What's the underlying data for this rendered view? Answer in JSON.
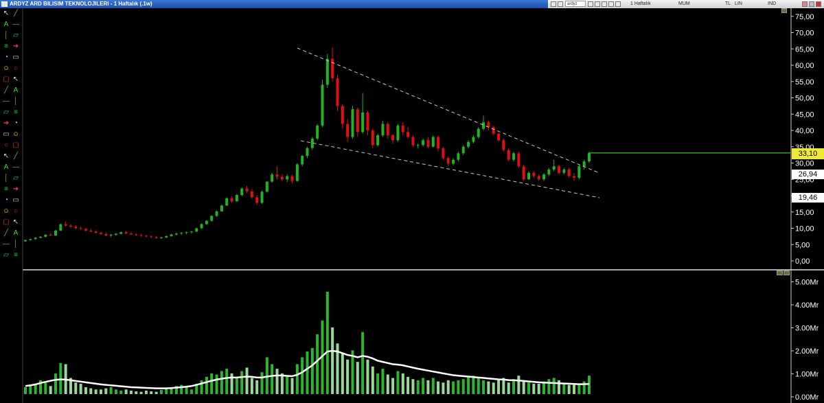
{
  "window": {
    "title": "ARDYZ ARD BILISIM TEKNOLOJILERI - 1 Haftalık (.1w)"
  },
  "toolbar_top": {
    "symbol_value": "ardyz",
    "period_label": "1 Haftalık",
    "mode_labels": [
      "MUM",
      "TL",
      "LIN",
      "IND"
    ]
  },
  "price_axis": {
    "ticks": [
      "75,00",
      "70,00",
      "65,00",
      "60,00",
      "55,00",
      "50,00",
      "45,00",
      "40,00",
      "35,00",
      "30,00",
      "25,00",
      "20,00",
      "15,00",
      "10,00",
      "5,00",
      "0,00"
    ],
    "current_price": "33,10",
    "ref_upper": "26,94",
    "ref_lower": "19,46"
  },
  "volume_axis": {
    "ticks": [
      "5.00Mr",
      "4.00Mr",
      "3.00Mr",
      "2.00Mr",
      "1.00Mr",
      "0.00Mr"
    ]
  },
  "colors": {
    "up": "#22b322",
    "down": "#e01010",
    "trendline": "#c8c8c8",
    "volume_up": "#2fb42f",
    "volume_down": "#9ad89a",
    "volume_avg": "#ffffff",
    "current_price_line": "#2aa02a"
  },
  "toolbar_icons": [
    "cursor-icon",
    "trendline-icon",
    "text-tool-icon",
    "horizontal-line-icon",
    "vertical-line-icon",
    "channel-icon",
    "fibonacci-icon",
    "arrow-icon",
    "zoom-icon",
    "eraser-icon",
    "smiley-icon",
    "ellipse-icon",
    "rectangle-icon"
  ],
  "chart_data": [
    {
      "type": "candlestick",
      "title": "",
      "ylim": [
        0,
        77
      ],
      "price_scale_ticks": [
        0,
        5,
        10,
        15,
        20,
        25,
        30,
        35,
        40,
        45,
        50,
        55,
        60,
        65,
        70,
        75
      ],
      "candles": [
        [
          6.0,
          6.5,
          5.9,
          6.4
        ],
        [
          6.4,
          6.8,
          6.2,
          6.7
        ],
        [
          6.7,
          7.3,
          6.5,
          7.1
        ],
        [
          7.1,
          7.6,
          6.9,
          7.4
        ],
        [
          7.4,
          8.2,
          7.2,
          8.0
        ],
        [
          8.0,
          8.5,
          7.6,
          7.8
        ],
        [
          7.8,
          9.5,
          7.6,
          9.3
        ],
        [
          9.3,
          11.5,
          9.1,
          11.2
        ],
        [
          11.2,
          12.1,
          10.5,
          10.8
        ],
        [
          10.8,
          11.4,
          10.1,
          10.5
        ],
        [
          10.5,
          11.0,
          9.8,
          10.0
        ],
        [
          10.0,
          10.5,
          9.5,
          9.8
        ],
        [
          9.8,
          10.2,
          9.0,
          9.3
        ],
        [
          9.3,
          9.8,
          8.7,
          9.0
        ],
        [
          9.0,
          9.4,
          8.4,
          8.6
        ],
        [
          8.6,
          9.0,
          8.0,
          8.2
        ],
        [
          8.2,
          8.7,
          7.6,
          7.8
        ],
        [
          7.8,
          8.3,
          7.3,
          8.0
        ],
        [
          8.0,
          8.5,
          7.7,
          8.3
        ],
        [
          8.3,
          9.0,
          8.1,
          8.8
        ],
        [
          8.8,
          9.2,
          8.2,
          8.4
        ],
        [
          8.4,
          8.8,
          7.9,
          8.1
        ],
        [
          8.1,
          8.5,
          7.6,
          7.9
        ],
        [
          7.9,
          8.3,
          7.4,
          7.7
        ],
        [
          7.7,
          8.0,
          7.2,
          7.5
        ],
        [
          7.5,
          7.8,
          7.0,
          7.3
        ],
        [
          7.3,
          7.6,
          6.8,
          7.0
        ],
        [
          7.0,
          7.4,
          6.7,
          7.2
        ],
        [
          7.2,
          7.8,
          7.0,
          7.6
        ],
        [
          7.6,
          8.3,
          7.4,
          8.1
        ],
        [
          8.1,
          8.6,
          7.8,
          8.4
        ],
        [
          8.4,
          8.8,
          8.0,
          8.6
        ],
        [
          8.6,
          9.0,
          8.2,
          8.8
        ],
        [
          8.8,
          9.2,
          8.4,
          9.0
        ],
        [
          9.0,
          10.2,
          8.8,
          10.0
        ],
        [
          10.0,
          11.5,
          9.8,
          11.3
        ],
        [
          11.3,
          12.5,
          11.0,
          12.3
        ],
        [
          12.3,
          14.0,
          12.0,
          13.8
        ],
        [
          13.8,
          15.5,
          13.5,
          15.2
        ],
        [
          15.2,
          17.2,
          15.0,
          17.0
        ],
        [
          17.0,
          19.5,
          16.8,
          19.2
        ],
        [
          19.2,
          19.8,
          17.8,
          18.3
        ],
        [
          18.3,
          20.5,
          18.0,
          20.2
        ],
        [
          20.2,
          22.5,
          19.8,
          22.2
        ],
        [
          22.2,
          23.0,
          20.8,
          21.3
        ],
        [
          21.3,
          22.0,
          19.0,
          19.5
        ],
        [
          19.5,
          20.2,
          17.2,
          17.8
        ],
        [
          17.8,
          21.5,
          17.5,
          21.2
        ],
        [
          21.2,
          24.5,
          21.0,
          24.3
        ],
        [
          24.3,
          27.0,
          24.0,
          26.5
        ],
        [
          26.5,
          29.0,
          25.0,
          25.8
        ],
        [
          25.8,
          26.6,
          24.5,
          25.0
        ],
        [
          25.0,
          26.5,
          24.2,
          26.0
        ],
        [
          26.0,
          26.4,
          23.8,
          24.5
        ],
        [
          24.5,
          30.0,
          24.3,
          29.6
        ],
        [
          29.6,
          32.5,
          29.0,
          32.2
        ],
        [
          32.2,
          35.0,
          31.5,
          34.6
        ],
        [
          34.6,
          38.0,
          34.0,
          37.5
        ],
        [
          37.5,
          42.0,
          37.0,
          41.5
        ],
        [
          41.5,
          55.5,
          41.0,
          54.0
        ],
        [
          54.0,
          63.5,
          53.0,
          62.0
        ],
        [
          62.0,
          65.5,
          55.0,
          56.0
        ],
        [
          56.0,
          57.0,
          46.0,
          47.5
        ],
        [
          47.5,
          48.0,
          40.5,
          42.0
        ],
        [
          42.0,
          43.5,
          36.5,
          38.0
        ],
        [
          38.0,
          47.5,
          37.5,
          46.5
        ],
        [
          46.5,
          47.0,
          38.0,
          39.5
        ],
        [
          39.5,
          51.5,
          39.0,
          45.5
        ],
        [
          45.5,
          46.0,
          38.5,
          40.0
        ],
        [
          40.0,
          40.5,
          34.5,
          35.5
        ],
        [
          35.5,
          39.0,
          35.0,
          38.5
        ],
        [
          38.5,
          43.0,
          38.0,
          42.0
        ],
        [
          42.0,
          42.5,
          37.5,
          38.5
        ],
        [
          38.5,
          39.0,
          36.0,
          37.0
        ],
        [
          37.0,
          42.0,
          36.5,
          41.5
        ],
        [
          41.5,
          42.5,
          38.5,
          39.5
        ],
        [
          39.5,
          41.0,
          37.5,
          38.0
        ],
        [
          38.0,
          38.5,
          35.0,
          35.5
        ],
        [
          35.5,
          36.0,
          34.5,
          35.5
        ],
        [
          35.5,
          37.5,
          35.0,
          37.0
        ],
        [
          37.0,
          38.0,
          34.5,
          35.0
        ],
        [
          35.0,
          38.5,
          34.8,
          38.0
        ],
        [
          38.0,
          38.5,
          33.5,
          34.5
        ],
        [
          34.5,
          35.0,
          31.0,
          31.5
        ],
        [
          31.5,
          32.0,
          29.0,
          29.8
        ],
        [
          29.8,
          31.5,
          29.3,
          31.0
        ],
        [
          31.0,
          33.5,
          30.5,
          33.0
        ],
        [
          33.0,
          35.5,
          32.5,
          35.0
        ],
        [
          35.0,
          37.0,
          34.5,
          36.5
        ],
        [
          36.5,
          38.5,
          36.0,
          38.0
        ],
        [
          38.0,
          41.0,
          37.5,
          40.5
        ],
        [
          40.5,
          44.5,
          40.0,
          42.5
        ],
        [
          42.5,
          43.0,
          40.0,
          41.0
        ],
        [
          41.0,
          41.5,
          38.5,
          39.0
        ],
        [
          39.0,
          39.5,
          36.5,
          37.0
        ],
        [
          37.0,
          37.5,
          33.5,
          34.0
        ],
        [
          34.0,
          34.5,
          30.5,
          31.0
        ],
        [
          31.0,
          33.5,
          30.5,
          33.0
        ],
        [
          33.0,
          33.5,
          28.5,
          29.0
        ],
        [
          29.0,
          29.5,
          24.5,
          25.0
        ],
        [
          25.0,
          27.5,
          24.8,
          27.0
        ],
        [
          27.0,
          27.5,
          25.5,
          26.0
        ],
        [
          26.0,
          26.5,
          24.5,
          25.0
        ],
        [
          25.0,
          27.0,
          24.5,
          26.5
        ],
        [
          26.5,
          28.5,
          26.0,
          28.0
        ],
        [
          28.0,
          31.0,
          27.5,
          29.0
        ],
        [
          29.0,
          29.5,
          26.5,
          27.0
        ],
        [
          27.0,
          28.5,
          26.5,
          28.0
        ],
        [
          28.0,
          28.5,
          25.5,
          26.0
        ],
        [
          26.0,
          27.0,
          24.5,
          25.5
        ],
        [
          25.5,
          29.5,
          25.0,
          29.0
        ],
        [
          29.0,
          31.0,
          28.0,
          30.5
        ],
        [
          30.5,
          33.5,
          30.0,
          33.1
        ]
      ]
    },
    {
      "type": "bar",
      "title": "",
      "ylabel": "",
      "ylim": [
        0,
        5.2
      ],
      "unit": "Mr",
      "volume": [
        0.3,
        0.4,
        0.45,
        0.6,
        0.5,
        0.35,
        0.9,
        1.35,
        1.3,
        0.7,
        0.5,
        0.45,
        0.3,
        0.25,
        0.2,
        0.2,
        0.25,
        0.3,
        0.2,
        0.15,
        0.2,
        0.15,
        0.12,
        0.1,
        0.15,
        0.12,
        0.1,
        0.18,
        0.25,
        0.3,
        0.35,
        0.4,
        0.3,
        0.2,
        0.45,
        0.6,
        0.75,
        0.9,
        0.85,
        1.0,
        1.1,
        0.9,
        0.75,
        1.0,
        1.15,
        0.7,
        0.6,
        0.95,
        1.6,
        1.3,
        1.1,
        0.9,
        0.8,
        0.7,
        1.3,
        1.6,
        1.85,
        2.0,
        2.6,
        3.2,
        4.45,
        2.9,
        2.2,
        1.8,
        1.5,
        1.9,
        1.4,
        2.7,
        1.5,
        1.2,
        0.9,
        1.1,
        0.85,
        0.7,
        1.0,
        0.9,
        0.75,
        0.65,
        0.6,
        0.7,
        0.6,
        0.7,
        0.55,
        0.5,
        0.6,
        0.55,
        0.6,
        0.65,
        0.75,
        0.8,
        0.7,
        0.6,
        0.55,
        0.5,
        0.6,
        0.7,
        0.5,
        0.65,
        0.8,
        0.6,
        0.5,
        0.45,
        0.45,
        0.55,
        0.65,
        0.7,
        0.6,
        0.45,
        0.4,
        0.4,
        0.45,
        0.55,
        0.8
      ],
      "volume_avg": [
        0.35,
        0.38,
        0.42,
        0.48,
        0.53,
        0.58,
        0.62,
        0.64,
        0.63,
        0.6,
        0.57,
        0.54,
        0.51,
        0.48,
        0.45,
        0.42,
        0.4,
        0.38,
        0.36,
        0.34,
        0.32,
        0.3,
        0.29,
        0.28,
        0.27,
        0.26,
        0.25,
        0.25,
        0.25,
        0.26,
        0.28,
        0.3,
        0.32,
        0.35,
        0.4,
        0.46,
        0.52,
        0.58,
        0.63,
        0.67,
        0.7,
        0.72,
        0.72,
        0.74,
        0.76,
        0.75,
        0.72,
        0.72,
        0.76,
        0.79,
        0.81,
        0.81,
        0.79,
        0.78,
        0.84,
        0.95,
        1.1,
        1.25,
        1.45,
        1.65,
        1.85,
        1.88,
        1.85,
        1.78,
        1.7,
        1.66,
        1.6,
        1.66,
        1.62,
        1.55,
        1.45,
        1.4,
        1.35,
        1.3,
        1.28,
        1.25,
        1.2,
        1.15,
        1.1,
        1.06,
        1.02,
        0.98,
        0.94,
        0.9,
        0.86,
        0.82,
        0.8,
        0.78,
        0.76,
        0.74,
        0.72,
        0.7,
        0.68,
        0.66,
        0.64,
        0.63,
        0.61,
        0.6,
        0.59,
        0.57,
        0.55,
        0.53,
        0.51,
        0.5,
        0.49,
        0.48,
        0.47,
        0.46,
        0.45,
        0.44,
        0.43,
        0.43,
        0.44
      ]
    }
  ]
}
